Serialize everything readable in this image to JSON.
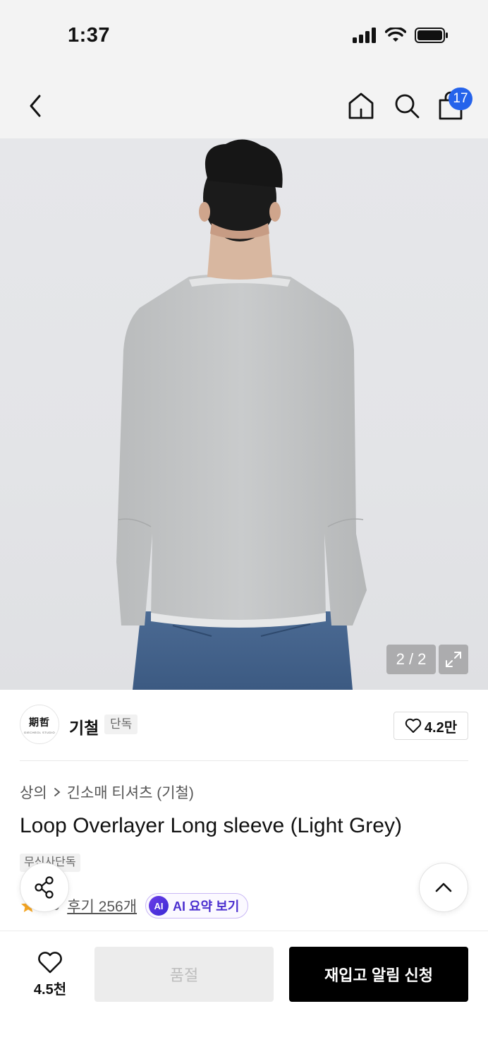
{
  "status_bar": {
    "time": "1:37"
  },
  "nav": {
    "back_icon": "chevron-left-icon",
    "home_icon": "home-icon",
    "search_icon": "search-icon",
    "bag_icon": "shopping-bag-icon",
    "cart_count": "17",
    "badge_color": "#2563eb"
  },
  "gallery": {
    "counter": "2 / 2",
    "expand_icon": "expand-icon"
  },
  "brand": {
    "logo_text": "期哲",
    "logo_subtext": "GIECHEOL STUDIO",
    "name": "기철",
    "tag": "단독",
    "likes": "4.2만"
  },
  "product": {
    "breadcrumb": [
      "상의",
      "긴소매 티셔츠 (기철)"
    ],
    "title": "Loop Overlayer Long sleeve (Light Grey)",
    "exclusive_tag": "무신사단독",
    "rating": "4.9",
    "reviews_link": "후기 256개",
    "ai_badge": "AI",
    "ai_summary_label": "AI 요약 보기"
  },
  "floating": {
    "share_icon": "share-icon",
    "scroll_top_icon": "chevron-up-icon"
  },
  "bottom_bar": {
    "wish_count": "4.5천",
    "soldout_label": "품절",
    "restock_label": "재입고 알림 신청",
    "primary_color": "#000000"
  }
}
